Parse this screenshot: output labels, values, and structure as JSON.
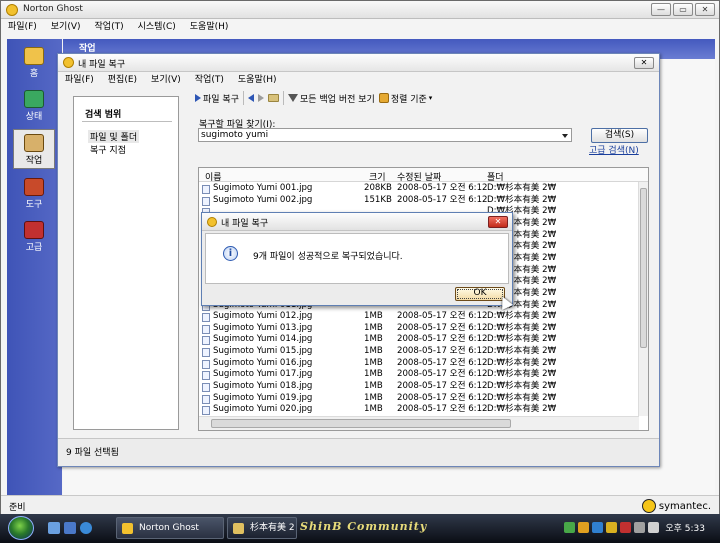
{
  "main_window": {
    "title": "Norton Ghost",
    "menu": [
      "파일(F)",
      "보기(V)",
      "작업(T)",
      "시스템(C)",
      "도움말(H)"
    ],
    "controls": {
      "minimize": "—",
      "maximize": "▭",
      "close": "✕"
    },
    "sidebar": [
      {
        "label": "홈",
        "icon": "home-icon"
      },
      {
        "label": "상태",
        "icon": "status-icon"
      },
      {
        "label": "작업",
        "icon": "tasks-icon",
        "active": true
      },
      {
        "label": "도구",
        "icon": "tools-icon"
      },
      {
        "label": "고급",
        "icon": "advanced-icon"
      }
    ],
    "work_header": "작업",
    "status": "준비",
    "brand": "symantec."
  },
  "restore_window": {
    "title": "내 파일 복구",
    "close": "✕",
    "menu": [
      "파일(F)",
      "편집(E)",
      "보기(V)",
      "작업(T)",
      "도움말(H)"
    ],
    "search_panel": {
      "heading": "검색 범위",
      "items": [
        "파일 및 폴더",
        "복구 지점"
      ]
    },
    "toolbar": {
      "restore": "파일 복구",
      "all_versions": "모든 백업 버전 보기",
      "sort": "정렬 기준"
    },
    "find": {
      "label": "복구할 파일 찾기(I):",
      "value": "sugimoto yumi",
      "search_button": "검색(S)",
      "advanced_link": "고급 검색(N)"
    },
    "columns": [
      "이름",
      "크기",
      "수정된 날짜",
      "폴더"
    ],
    "files": [
      {
        "name": "Sugimoto Yumi 001.jpg",
        "size": "208KB",
        "date": "2008-05-17 오전 6:12",
        "folder": "D:₩杉本有美 2₩"
      },
      {
        "name": "Sugimoto Yumi 002.jpg",
        "size": "151KB",
        "date": "2008-05-17 오전 6:12",
        "folder": "D:₩杉本有美 2₩"
      },
      {
        "name": "",
        "size": "",
        "date": "",
        "folder": "D:₩杉本有美 2₩"
      },
      {
        "name": "",
        "size": "",
        "date": "",
        "folder": "D:₩杉本有美 2₩"
      },
      {
        "name": "",
        "size": "",
        "date": "",
        "folder": "D:₩杉本有美 2₩"
      },
      {
        "name": "",
        "size": "",
        "date": "",
        "folder": "D:₩杉本有美 2₩"
      },
      {
        "name": "",
        "size": "",
        "date": "",
        "folder": "D:₩杉本有美 2₩"
      },
      {
        "name": "",
        "size": "",
        "date": "",
        "folder": "D:₩杉本有美 2₩"
      },
      {
        "name": "",
        "size": "",
        "date": "",
        "folder": "D:₩杉本有美 2₩"
      },
      {
        "name": "",
        "size": "",
        "date": "",
        "folder": "D:₩杉本有美 2₩"
      },
      {
        "name": "Sugimoto Yumi 011.jpg",
        "size": "",
        "date": "",
        "folder": "D:₩杉本有美 2₩"
      },
      {
        "name": "Sugimoto Yumi 012.jpg",
        "size": "1MB",
        "date": "2008-05-17 오전 6:12",
        "folder": "D:₩杉本有美 2₩"
      },
      {
        "name": "Sugimoto Yumi 013.jpg",
        "size": "1MB",
        "date": "2008-05-17 오전 6:12",
        "folder": "D:₩杉本有美 2₩"
      },
      {
        "name": "Sugimoto Yumi 014.jpg",
        "size": "1MB",
        "date": "2008-05-17 오전 6:12",
        "folder": "D:₩杉本有美 2₩"
      },
      {
        "name": "Sugimoto Yumi 015.jpg",
        "size": "1MB",
        "date": "2008-05-17 오전 6:12",
        "folder": "D:₩杉本有美 2₩"
      },
      {
        "name": "Sugimoto Yumi 016.jpg",
        "size": "1MB",
        "date": "2008-05-17 오전 6:12",
        "folder": "D:₩杉本有美 2₩"
      },
      {
        "name": "Sugimoto Yumi 017.jpg",
        "size": "1MB",
        "date": "2008-05-17 오전 6:12",
        "folder": "D:₩杉本有美 2₩"
      },
      {
        "name": "Sugimoto Yumi 018.jpg",
        "size": "1MB",
        "date": "2008-05-17 오전 6:12",
        "folder": "D:₩杉本有美 2₩"
      },
      {
        "name": "Sugimoto Yumi 019.jpg",
        "size": "1MB",
        "date": "2008-05-17 오전 6:12",
        "folder": "D:₩杉本有美 2₩"
      },
      {
        "name": "Sugimoto Yumi 020.jpg",
        "size": "1MB",
        "date": "2008-05-17 오전 6:12",
        "folder": "D:₩杉本有美 2₩"
      }
    ],
    "status": "9 파일 선택됨"
  },
  "dialog": {
    "title": "내 파일 복구",
    "close": "✕",
    "icon": "info-icon",
    "icon_glyph": "i",
    "message": "9개 파일이 성공적으로 복구되었습니다.",
    "ok": "OK"
  },
  "taskbar": {
    "tasks": [
      "Norton Ghost",
      "杉本有美 2"
    ],
    "community": "ShinB Community",
    "clock": "오후 5:33"
  }
}
